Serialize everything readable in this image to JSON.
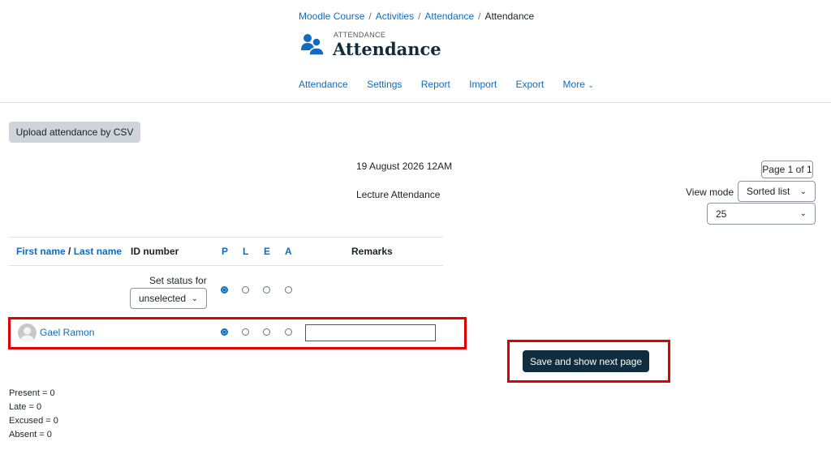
{
  "breadcrumb": [
    "Moodle Course",
    "Activities",
    "Attendance",
    "Attendance"
  ],
  "activity": {
    "subtitle": "ATTENDANCE",
    "title": "Attendance",
    "icon": "attendance-people-icon",
    "icon_color": "#0f6cbf"
  },
  "secondary_nav": [
    "Attendance",
    "Settings",
    "Report",
    "Import",
    "Export",
    "More"
  ],
  "upload_button": "Upload attendance by CSV",
  "session": {
    "date": "19 August 2026 12AM",
    "description": "Lecture Attendance"
  },
  "pager": "Page 1 of 1",
  "view_mode": {
    "label": "View mode",
    "selected": "Sorted list"
  },
  "per_page": {
    "selected": "25"
  },
  "table": {
    "header": {
      "first_name": "First name",
      "slash": " / ",
      "last_name": "Last name",
      "id_number": "ID number",
      "p": "P",
      "l": "L",
      "e": "E",
      "a": "A",
      "remarks": "Remarks"
    },
    "set_status": {
      "label": "Set status for",
      "selected": "unselected"
    },
    "rows": [
      {
        "name": "Gael Ramon",
        "status": "P",
        "remarks": ""
      }
    ]
  },
  "save_button": "Save and show next page",
  "summary": [
    "Present = 0",
    "Late = 0",
    "Excused = 0",
    "Absent = 0"
  ],
  "colors": {
    "link": "#0f6cbf",
    "primary": "#0f2d3f",
    "highlight": "#e00000"
  }
}
